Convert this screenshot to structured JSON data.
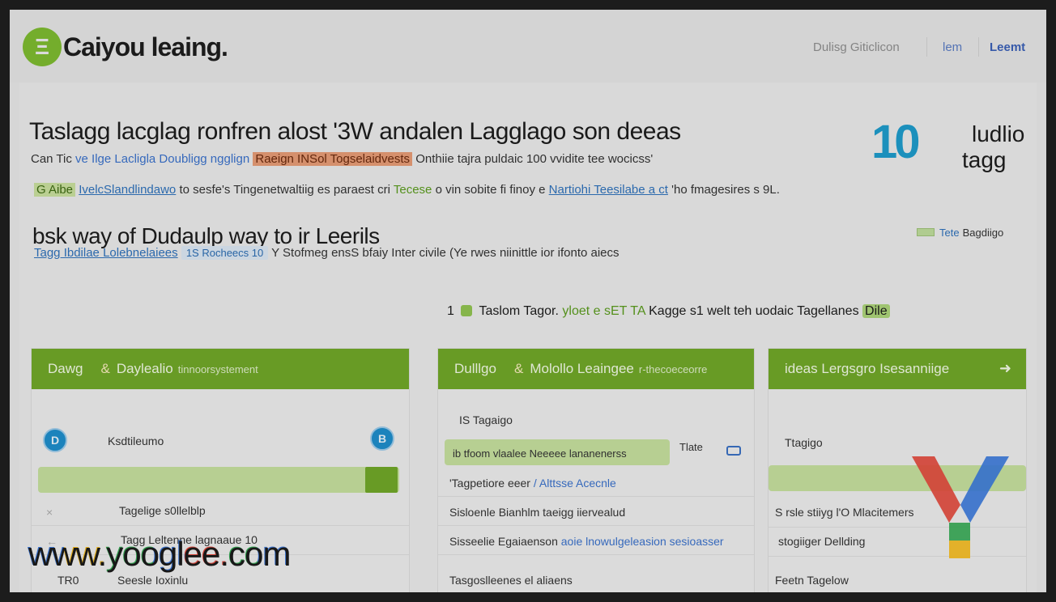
{
  "header": {
    "logo_mark": "Ξ",
    "logo_text": "Caiyou leaing.",
    "nav": [
      "Dulisg Giticlicon",
      "lem",
      "Leemt"
    ]
  },
  "hero": {
    "title": "Taslagg lacglag ronfren alost '3W andalen Lagglago son deeas",
    "line1": {
      "a": "Can Tic",
      "b": "ve Ilge Lacligla Doubligg ngglign",
      "c": "Raeign INSol Togselaidvests",
      "d": "Onthiie tajra puldaic 100 vvidite tee wocicss'"
    },
    "line2": {
      "a": "G Aibe",
      "b": "IvelcSlandlindawo",
      "c": "to sesfe's Tingenetwaltiig es paraest cri",
      "d": "Tecese",
      "e": "o vin sobite fi finoy e",
      "f": "Nartiohi Teesilabe a ct",
      "g": "'ho fmagesires s 9L."
    },
    "subtitle": "bsk way of Dudaulp way to ir Leerils",
    "line3": {
      "a": "Tagg Ibdilae Lolebnelaiees",
      "b": "1S Rocheecs 10",
      "c": "Y Stofmeg ensS bfaiy Inter civile (Ye rwes niinittle ior ifonto aiecs"
    },
    "big_number": "10",
    "big_side_1": "ludlio",
    "big_side_2": "tagg",
    "tag_chip": {
      "link": "Tete",
      "label": "Bagdiigo"
    },
    "step": {
      "num": "1",
      "a": "Taslom Tagor.",
      "b": "yloet e sET TA",
      "c": "Kagge",
      "d": "s1 welt teh uodaic Tagellanes",
      "e": "Dile"
    }
  },
  "cards": [
    {
      "title": "Dawg",
      "amp": "&",
      "subtitle": "Daylealio",
      "tiny": "tinnoorsystement",
      "rows": [
        "Ksdtileumo",
        "Tagelige s0llelblp",
        "Tagg Leltenne lagnaaue 10",
        "Seesle Ioxinlu"
      ],
      "row_left": "TR0",
      "dot1": "D",
      "dot2": "B"
    },
    {
      "title": "Dulllgo",
      "amp": "&",
      "subtitle": "Molollo Leaingee",
      "tiny": "r-thecoeceorre",
      "rows": [
        "IS Tagaigo",
        "ib tfoom vlaalee Neeeee lananenerss",
        "'Tagpetiore eeer",
        "/ Alttsse Acecnle",
        "Sisloenle Bianhlm taeigg iiervealud",
        "Sisseelie Egaiaenson",
        "aoie lnowulgeleasion sesioasser",
        "Tasgoslleenes el aliaens"
      ],
      "badge": "Tlate"
    },
    {
      "title": "ideas Lergsgro Isesanniige",
      "arrow": "➜",
      "rows": [
        "Ttagigo",
        "S rsle stiiyg l'O Mlacitemers",
        "stogiiger Dellding",
        "Feetn Tagelow"
      ]
    }
  ],
  "watermark": "www.yooglee.com",
  "colors": {
    "accent_green": "#6fa528",
    "accent_blue": "#1e8cc8",
    "highlight_orange": "#e39a74"
  }
}
